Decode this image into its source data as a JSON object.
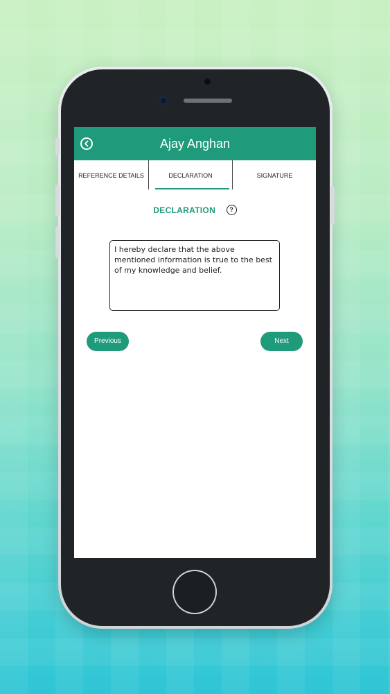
{
  "header": {
    "title": "Ajay Anghan"
  },
  "tabs": [
    {
      "label": "REFERENCE DETAILS",
      "active": false
    },
    {
      "label": "DECLARATION",
      "active": true
    },
    {
      "label": "SIGNATURE",
      "active": false
    }
  ],
  "section": {
    "title": "DECLARATION"
  },
  "declaration": {
    "text": "I hereby declare that the above mentioned information is true to the best of my knowledge and belief."
  },
  "buttons": {
    "previous": "Previous",
    "next": "Next"
  },
  "colors": {
    "accent": "#1f9b7b",
    "phone_body": "#202427"
  },
  "icons": {
    "back": "back-arrow-circle-icon",
    "help": "question-circle-icon"
  }
}
